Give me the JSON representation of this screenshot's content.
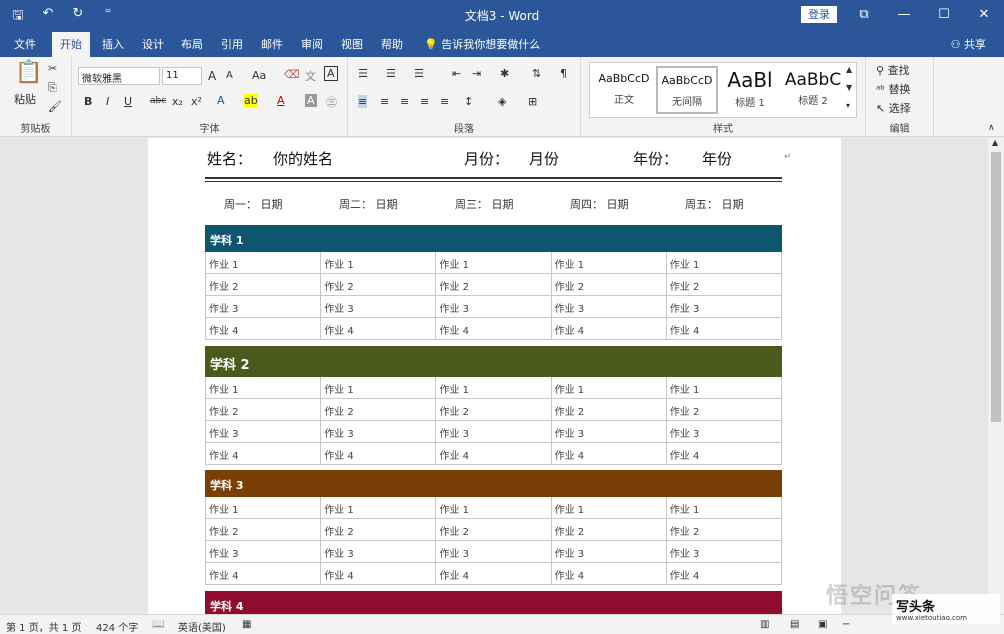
{
  "window": {
    "title": "文档3  -  Word",
    "signin": "登录",
    "min": "—",
    "max": "☐",
    "close": "✕",
    "ribbon_display": "⧉"
  },
  "qat": {
    "save": "🖫",
    "undo": "↶",
    "redo": "↻",
    "customize": "⁼"
  },
  "tabs": [
    "文件",
    "开始",
    "插入",
    "设计",
    "布局",
    "引用",
    "邮件",
    "审阅",
    "视图",
    "帮助"
  ],
  "tellme": "告诉我你想要做什么",
  "share": "共享",
  "ribbon": {
    "clipboard": {
      "label": "剪贴板",
      "paste": "粘贴"
    },
    "font": {
      "label": "字体",
      "name": "微软雅黑",
      "size": "11",
      "grow": "A",
      "shrink": "A",
      "case": "Aa",
      "bold": "B",
      "italic": "I",
      "underline": "U",
      "strike": "abc",
      "sub": "x₂",
      "sup": "x²"
    },
    "paragraph": {
      "label": "段落"
    },
    "styles": {
      "label": "样式",
      "items": [
        {
          "sample": "AaBbCcD",
          "name": "正文"
        },
        {
          "sample": "AaBbCcD",
          "name": "无间隔"
        },
        {
          "sample": "AaBl",
          "name": "标题 1"
        },
        {
          "sample": "AaBbC",
          "name": "标题 2"
        }
      ]
    },
    "editing": {
      "label": "编辑",
      "find": "查找",
      "replace": "替换",
      "select": "选择"
    }
  },
  "document": {
    "header": {
      "name_label": "姓名：",
      "name_value": "你的姓名",
      "month_label": "月份：",
      "month_value": "月份",
      "year_label": "年份：",
      "year_value": "年份"
    },
    "days": [
      {
        "label": "周一：",
        "value": "日期"
      },
      {
        "label": "周二：",
        "value": "日期"
      },
      {
        "label": "周三：",
        "value": "日期"
      },
      {
        "label": "周四：",
        "value": "日期"
      },
      {
        "label": "周五：",
        "value": "日期"
      }
    ],
    "subjects": [
      {
        "title": "学科 1",
        "color": "#0e5670",
        "rows": [
          "作业 1",
          "作业 2",
          "作业 3",
          "作业 4"
        ]
      },
      {
        "title": "学科 2",
        "color": "#4a5a1c",
        "rows": [
          "作业 1",
          "作业 2",
          "作业 3",
          "作业 4"
        ]
      },
      {
        "title": "学科 3",
        "color": "#7a3f06",
        "rows": [
          "作业 1",
          "作业 2",
          "作业 3",
          "作业 4"
        ]
      },
      {
        "title": "学科 4",
        "color": "#8f0d2c",
        "rows": []
      }
    ],
    "para_mark": "↵"
  },
  "status": {
    "page": "第 1 页，共 1 页",
    "words": "424 个字",
    "language": "英语(美国)"
  },
  "watermark": {
    "text": "悟空问答",
    "logo_main": "写头条",
    "logo_sub": "www.xietoutiao.com"
  }
}
